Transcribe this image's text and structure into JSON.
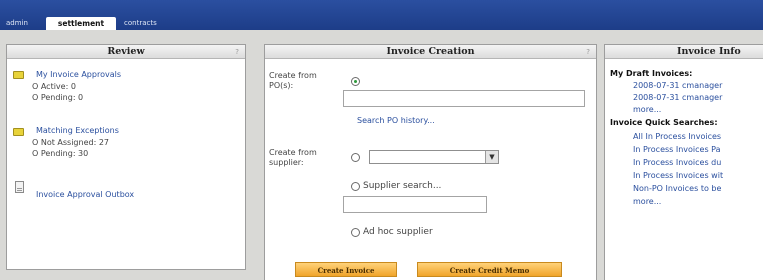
{
  "tabs": {
    "admin": "admin",
    "settlement": "settlement",
    "contracts": "contracts"
  },
  "review": {
    "title": "Review",
    "help": "?",
    "approvals_link": "My Invoice Approvals",
    "active": "O  Active: 0",
    "pending": "O  Pending: 0",
    "exceptions_link": "Matching Exceptions",
    "not_assigned": "O  Not Assigned: 27",
    "pending_exceptions": "O  Pending: 30",
    "outbox_link": "Invoice Approval Outbox"
  },
  "invoice_creation": {
    "title": "Invoice Creation",
    "help": "?",
    "from_po_label_1": "Create from",
    "from_po_label_2": "PO(s):",
    "po_input_value": "",
    "search_po_history": "Search PO history...",
    "from_supplier_label_1": "Create from",
    "from_supplier_label_2": "supplier:",
    "supplier_select_value": "",
    "supplier_search_label": "Supplier search...",
    "supplier_search_value": "",
    "ad_hoc_label": "Ad hoc supplier",
    "create_invoice_button": "Create Invoice",
    "create_credit_memo_button": "Create Credit Memo"
  },
  "invoice_info": {
    "title": "Invoice Info",
    "draft_heading": "My Draft Invoices:",
    "draft_items": [
      "2008-07-31 cmanager",
      "2008-07-31 cmanager"
    ],
    "draft_more": "more...",
    "quick_heading": "Invoice Quick Searches:",
    "quick_items": [
      "All In Process Invoices",
      "In Process Invoices Pa",
      "In Process Invoices du",
      "In Process Invoices wit",
      "Non-PO Invoices to be"
    ],
    "quick_more": "more..."
  }
}
